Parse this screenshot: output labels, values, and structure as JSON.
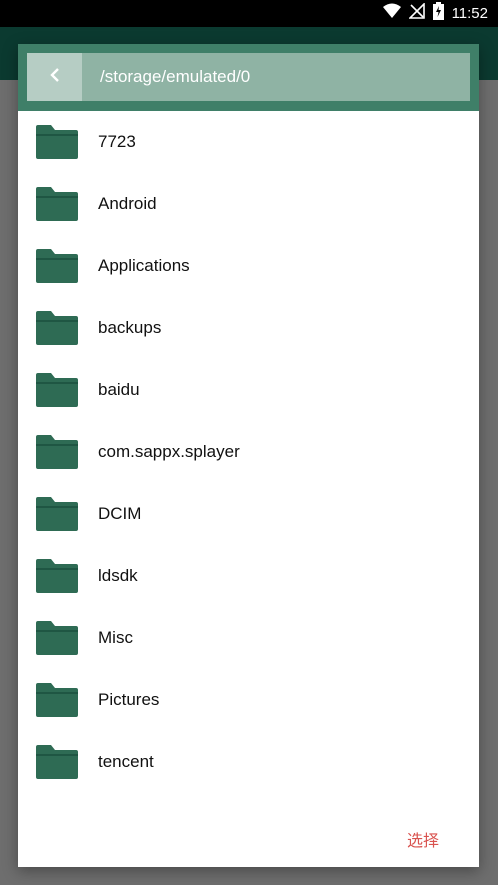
{
  "status_bar": {
    "time": "11:52",
    "icons": [
      "wifi-icon",
      "no-signal-icon",
      "battery-charging-icon"
    ]
  },
  "dialog": {
    "path": "/storage/emulated/0",
    "back_icon": "chevron-left-icon",
    "folders": [
      {
        "name": "7723"
      },
      {
        "name": "Android"
      },
      {
        "name": "Applications"
      },
      {
        "name": "backups"
      },
      {
        "name": "baidu"
      },
      {
        "name": "com.sappx.splayer"
      },
      {
        "name": "DCIM"
      },
      {
        "name": "ldsdk"
      },
      {
        "name": "Misc"
      },
      {
        "name": "Pictures"
      },
      {
        "name": "tencent"
      }
    ],
    "select_label": "选择"
  },
  "colors": {
    "header": "#3f7f68",
    "path_bar": "#8fb3a4",
    "folder": "#2e6b54",
    "select": "#d9534f"
  }
}
